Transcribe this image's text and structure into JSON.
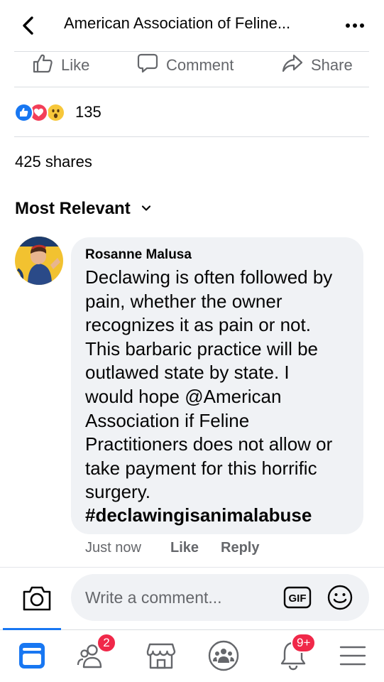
{
  "header": {
    "title": "American Association of Feline..."
  },
  "actions": {
    "like": "Like",
    "comment": "Comment",
    "share": "Share"
  },
  "reactions": {
    "count": "135",
    "types": [
      "like",
      "love",
      "wow"
    ]
  },
  "shares": "425 shares",
  "sort": {
    "label": "Most Relevant"
  },
  "comment": {
    "author": "Rosanne Malusa",
    "text": "Declawing is often followed by\npain, whether the owner\nrecognizes it as pain or not.\nThis barbaric practice will be\noutlawed state by state. I\nwould hope @American\nAssociation if Feline\nPractitioners does not allow or\ntake payment for this horrific\nsurgery.",
    "hashtag": "#declawingisanimalabuse",
    "time": "Just now",
    "like": "Like",
    "reply": "Reply"
  },
  "composer": {
    "placeholder": "Write a comment...",
    "gif": "GIF"
  },
  "nav": {
    "items": [
      "home",
      "friends",
      "marketplace",
      "groups",
      "notifications",
      "menu"
    ],
    "friends_badge": "2",
    "notifications_badge": "9+"
  },
  "colors": {
    "accent": "#1877f2",
    "badge": "#f02849",
    "bubble": "#f0f2f5",
    "muted": "#65676b"
  }
}
